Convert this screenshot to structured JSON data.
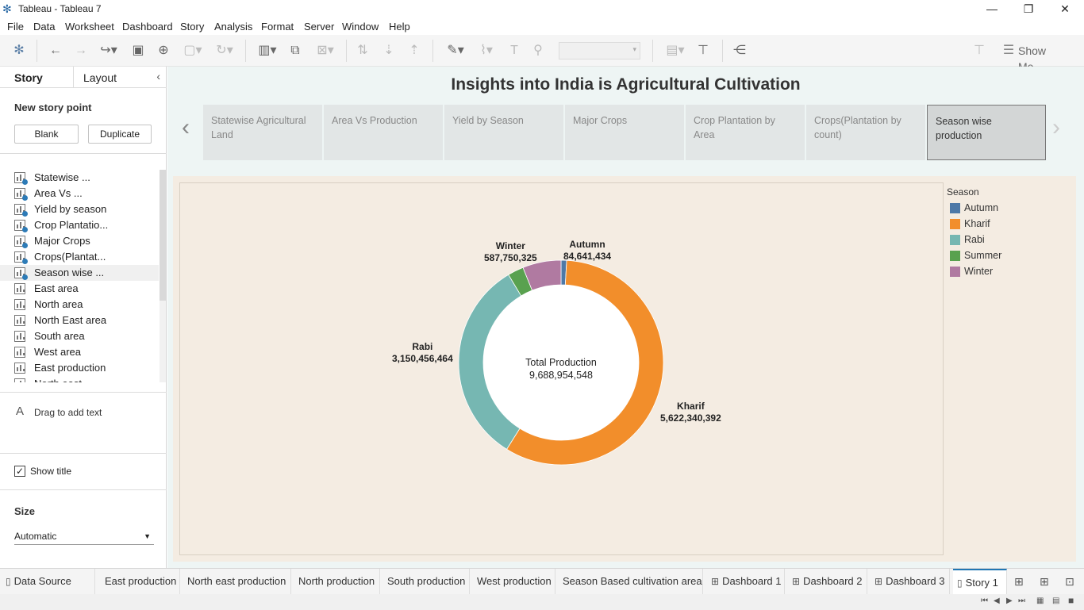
{
  "window": {
    "title": "Tableau - Tableau 7"
  },
  "menu": [
    "File",
    "Data",
    "Worksheet",
    "Dashboard",
    "Story",
    "Analysis",
    "Format",
    "Server",
    "Window",
    "Help"
  ],
  "toolbar": {
    "show_me": "Show Me"
  },
  "sidebar": {
    "tab_story": "Story",
    "tab_layout": "Layout",
    "new_story_point": "New story point",
    "blank": "Blank",
    "duplicate": "Duplicate",
    "sheets": [
      {
        "label": "Statewise ...",
        "used": true
      },
      {
        "label": "Area Vs ...",
        "used": true
      },
      {
        "label": "Yield by season",
        "used": true
      },
      {
        "label": "Crop Plantatio...",
        "used": true
      },
      {
        "label": "Major Crops",
        "used": true
      },
      {
        "label": "Crops(Plantat...",
        "used": true
      },
      {
        "label": "Season wise ...",
        "used": true
      },
      {
        "label": "East area",
        "used": false
      },
      {
        "label": "North area",
        "used": false
      },
      {
        "label": "North East area",
        "used": false
      },
      {
        "label": "South area",
        "used": false
      },
      {
        "label": "West area",
        "used": false
      },
      {
        "label": "East production",
        "used": false
      },
      {
        "label": "North east ...",
        "used": false
      }
    ],
    "drag_text": "Drag to add text",
    "show_title": "Show title",
    "size_title": "Size",
    "size_value": "Automatic"
  },
  "story": {
    "title": "Insights into India is Agricultural Cultivation",
    "points": [
      "Statewise Agricultural Land",
      "Area Vs Production",
      "Yield by Season",
      "Major Crops",
      "Crop Plantation by Area",
      "Crops(Plantation by count)",
      "Season wise production"
    ],
    "active_point": 6
  },
  "legend": {
    "title": "Season",
    "items": [
      {
        "label": "Autumn",
        "color": "#4e79a7"
      },
      {
        "label": "Kharif",
        "color": "#f28e2b"
      },
      {
        "label": "Rabi",
        "color": "#76b7b2"
      },
      {
        "label": "Summer",
        "color": "#59a14f"
      },
      {
        "label": "Winter",
        "color": "#b07aa1"
      }
    ]
  },
  "chart_data": {
    "type": "pie",
    "donut": true,
    "center_title": "Total Production",
    "center_value": "9,688,954,548",
    "series": [
      {
        "name": "Autumn",
        "value": 84641434,
        "label": "84,641,434",
        "color": "#4e79a7"
      },
      {
        "name": "Kharif",
        "value": 5622340392,
        "label": "5,622,340,392",
        "color": "#f28e2b"
      },
      {
        "name": "Rabi",
        "value": 3150456464,
        "label": "3,150,456,464",
        "color": "#76b7b2"
      },
      {
        "name": "Summer",
        "value": 243765933,
        "label": "",
        "color": "#59a14f"
      },
      {
        "name": "Winter",
        "value": 587750325,
        "label": "587,750,325",
        "color": "#b07aa1"
      }
    ]
  },
  "bottom_tabs": [
    {
      "label": "Data Source",
      "icon": "database-icon"
    },
    {
      "label": "East production",
      "icon": ""
    },
    {
      "label": "North east production",
      "icon": ""
    },
    {
      "label": "North production",
      "icon": ""
    },
    {
      "label": "South production",
      "icon": ""
    },
    {
      "label": "West production",
      "icon": ""
    },
    {
      "label": "Season Based cultivation area",
      "icon": ""
    },
    {
      "label": "Dashboard 1",
      "icon": "dashboard-icon"
    },
    {
      "label": "Dashboard 2",
      "icon": "dashboard-icon"
    },
    {
      "label": "Dashboard 3",
      "icon": "dashboard-icon"
    },
    {
      "label": "Story 1",
      "icon": "story-icon"
    }
  ]
}
